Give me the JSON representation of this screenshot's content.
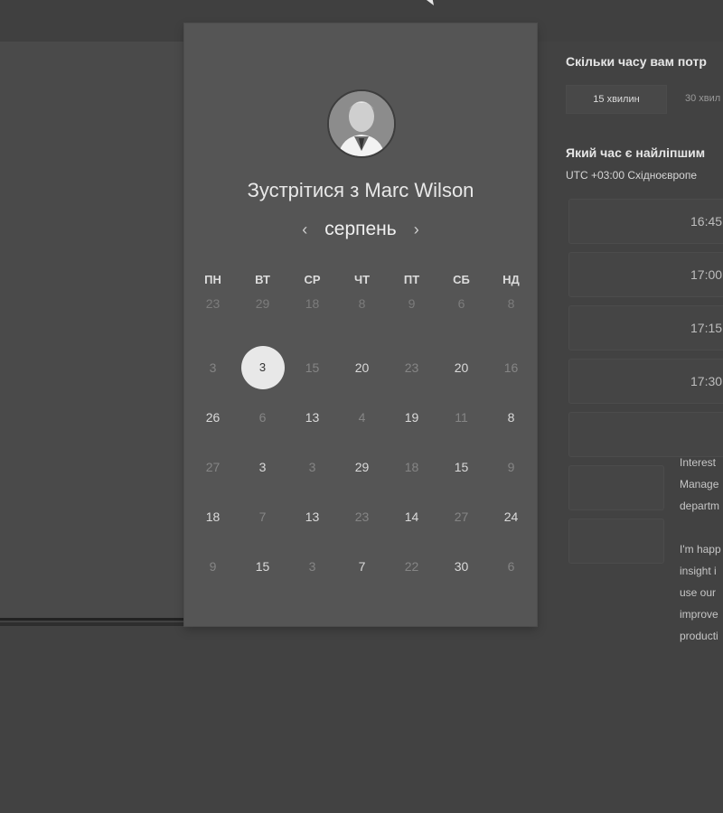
{
  "card": {
    "title_prefix": "Зустрітися з",
    "host_name": "Marc Wilson",
    "month": "серпень"
  },
  "weekdays": [
    "ПН",
    "ВТ",
    "СР",
    "ЧТ",
    "ПТ",
    "СБ",
    "НД"
  ],
  "calendar": {
    "rows": [
      [
        "23",
        "29",
        "18",
        "8",
        "9",
        "6",
        "8"
      ],
      [
        "3",
        "3",
        "15",
        "20",
        "23",
        "20",
        "16"
      ],
      [
        "26",
        "6",
        "13",
        "4",
        "19",
        "11",
        "8"
      ],
      [
        "27",
        "3",
        "3",
        "29",
        "18",
        "15",
        "9"
      ],
      [
        "18",
        "7",
        "13",
        "23",
        "14",
        "27",
        "24"
      ],
      [
        "9",
        "15",
        "3",
        "7",
        "22",
        "30",
        "6"
      ]
    ],
    "selected": {
      "row": 1,
      "col": 1
    }
  },
  "booking": {
    "duration_question": "Скільки часу вам потр",
    "durations": [
      "15 хвилин",
      "30 хвил"
    ],
    "time_question": "Який час є найліпшим",
    "timezone": "UTC +03:00 Східноєвропе",
    "slots": [
      "16:45",
      "17:00",
      "17:15",
      "17:30"
    ]
  },
  "note": {
    "para1": [
      "Interest",
      "Manage",
      "departm"
    ],
    "para2": [
      "I'm happ",
      "insight i",
      "use our",
      "improve",
      "producti"
    ]
  },
  "colors": {
    "background": "#424242",
    "card": "#555555",
    "selected_day": "#e8e8e8"
  }
}
